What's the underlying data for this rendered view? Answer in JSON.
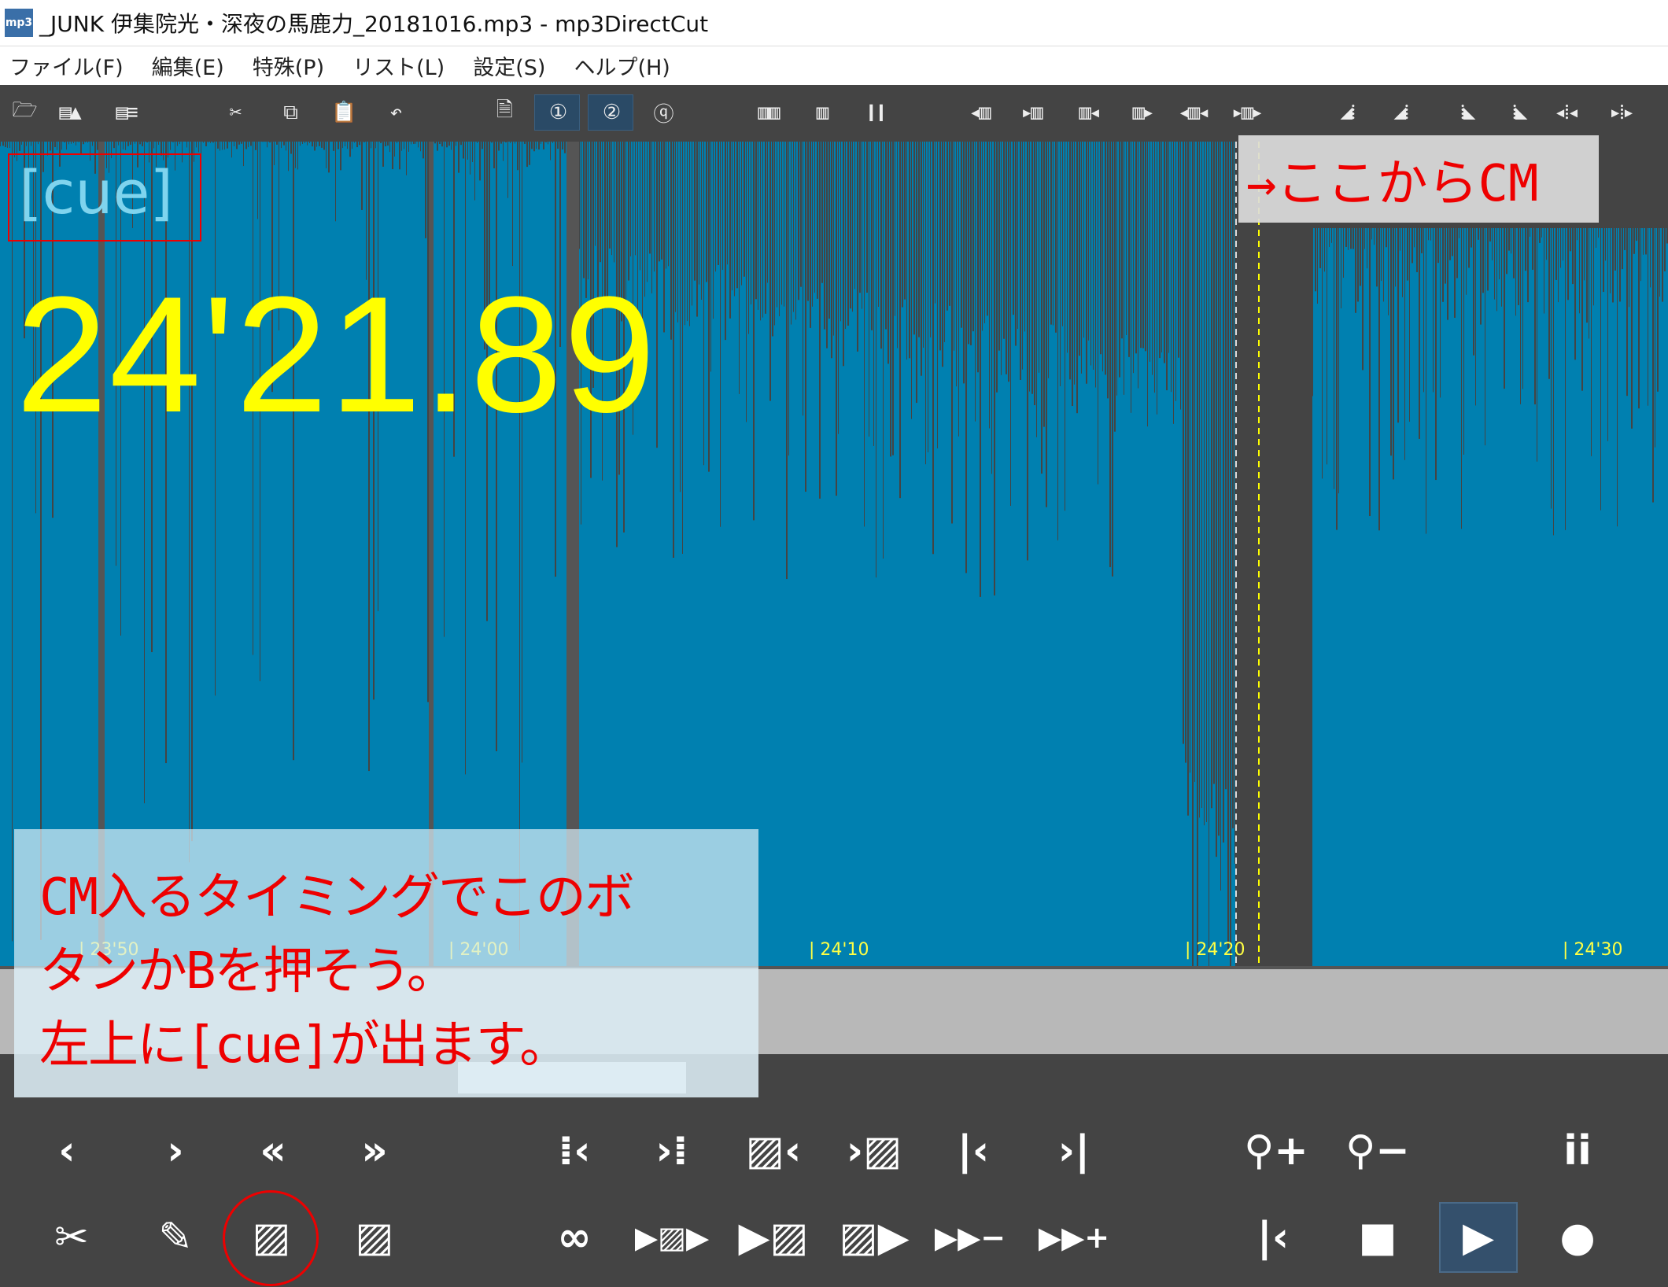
{
  "window": {
    "title": "_JUNK 伊集院光・深夜の馬鹿力_20181016.mp3 - mp3DirectCut",
    "icon": "mp3"
  },
  "menu": [
    "ファイル(F)",
    "編集(E)",
    "特殊(P)",
    "リスト(L)",
    "設定(S)",
    "ヘルプ(H)"
  ],
  "toolbar": [
    {
      "icon": "open-folder-icon",
      "glyph": "🗁"
    },
    {
      "icon": "save-audio-icon",
      "glyph": "▤▲"
    },
    {
      "icon": "save-list-icon",
      "glyph": "▤≡"
    },
    {
      "icon": "cut-icon",
      "glyph": "✂"
    },
    {
      "icon": "copy-icon",
      "glyph": "⧉"
    },
    {
      "icon": "paste-icon",
      "glyph": "📋"
    },
    {
      "icon": "undo-icon",
      "glyph": "↶"
    },
    {
      "icon": "page-icon",
      "glyph": "🗎"
    },
    {
      "icon": "page-1-icon",
      "glyph": "①",
      "active": true
    },
    {
      "icon": "page-2-icon",
      "glyph": "②",
      "active": true
    },
    {
      "icon": "page-q-icon",
      "glyph": "ⓠ"
    },
    {
      "icon": "marker-many-icon",
      "glyph": "▥▥"
    },
    {
      "icon": "marker-icon",
      "glyph": "▥"
    },
    {
      "icon": "pause-bars-icon",
      "glyph": "❙❙"
    },
    {
      "icon": "arrow-left-marker-icon",
      "glyph": "◂▥"
    },
    {
      "icon": "arrow-right-marker-icon",
      "glyph": "▸▥"
    },
    {
      "icon": "marker-arrow-left-icon",
      "glyph": "▥◂"
    },
    {
      "icon": "marker-arrow-right-icon",
      "glyph": "▥▸"
    },
    {
      "icon": "marker-squeeze-icon",
      "glyph": "◂▥◂"
    },
    {
      "icon": "marker-expand-icon",
      "glyph": "▸▥▸"
    },
    {
      "icon": "fade-in-left-icon",
      "glyph": "◢⁞"
    },
    {
      "icon": "fade-in-right-icon",
      "glyph": "◢⁞"
    },
    {
      "icon": "fade-out-left-icon",
      "glyph": "⁞◣"
    },
    {
      "icon": "fade-out-right-icon",
      "glyph": "⁞◣"
    },
    {
      "icon": "split-left-icon",
      "glyph": "◂⁞◂"
    },
    {
      "icon": "split-right-icon",
      "glyph": "▸⁞▸"
    }
  ],
  "wave": {
    "cue_label": "[cue]",
    "time": "24'21.89",
    "ticks": [
      "| 23'50",
      "| 24'00",
      "| 24'10",
      "| 24'20",
      "| 24'30"
    ],
    "wave_color": "#0080b0",
    "cursor_color": "#ffff00"
  },
  "annotations": {
    "top": "→ここからCM",
    "bottom": [
      "CM入るタイミングでこのボ",
      "タンかBを押そう。",
      "左上に[cue]が出ます。"
    ]
  },
  "controls_row1": [
    {
      "icon": "prev-icon",
      "glyph": "‹"
    },
    {
      "icon": "next-icon",
      "glyph": "›"
    },
    {
      "icon": "rewind-icon",
      "glyph": "«"
    },
    {
      "icon": "fast-forward-icon",
      "glyph": "»"
    },
    {
      "icon": "go-sel-start-icon",
      "glyph": "⁞‹"
    },
    {
      "icon": "go-sel-end-icon",
      "glyph": "›⁞"
    },
    {
      "icon": "go-block-start-icon",
      "glyph": "▨‹"
    },
    {
      "icon": "go-block-end-icon",
      "glyph": "›▨"
    },
    {
      "icon": "go-start-icon",
      "glyph": "|‹"
    },
    {
      "icon": "go-end-icon",
      "glyph": "›|"
    },
    {
      "icon": "zoom-in-icon",
      "glyph": "⚲+"
    },
    {
      "icon": "zoom-out-icon",
      "glyph": "⚲−"
    },
    {
      "icon": "info-icon",
      "glyph": "ii"
    }
  ],
  "controls_row2": [
    {
      "icon": "scissors-icon",
      "glyph": "✂"
    },
    {
      "icon": "pencil-icon",
      "glyph": "✎"
    },
    {
      "icon": "cue-marker-icon",
      "glyph": "▨"
    },
    {
      "icon": "block-icon",
      "glyph": "▨"
    },
    {
      "icon": "loop-icon",
      "glyph": "∞"
    },
    {
      "icon": "play-block-icon",
      "glyph": "▶▨▶"
    },
    {
      "icon": "play-to-marker-icon",
      "glyph": "▶▨"
    },
    {
      "icon": "play-from-marker-icon",
      "glyph": "▨▶"
    },
    {
      "icon": "speed-down-icon",
      "glyph": "▶▶−"
    },
    {
      "icon": "speed-up-icon",
      "glyph": "▶▶+"
    },
    {
      "icon": "skip-start-icon",
      "glyph": "|‹"
    },
    {
      "icon": "stop-icon",
      "glyph": "■"
    },
    {
      "icon": "play-icon",
      "glyph": "▶",
      "active": true
    },
    {
      "icon": "record-icon",
      "glyph": "●"
    }
  ]
}
